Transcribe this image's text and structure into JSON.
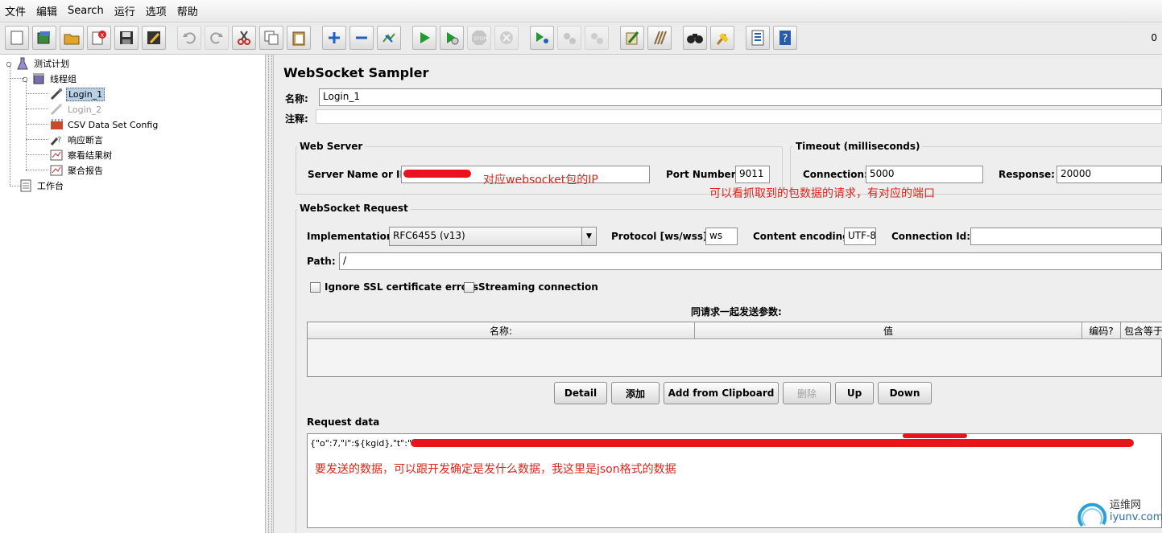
{
  "menu": [
    "文件",
    "编辑",
    "Search",
    "运行",
    "选项",
    "帮助"
  ],
  "toolbar": {
    "icons": [
      "new-icon",
      "templates-icon",
      "open-icon",
      "close-icon",
      "save-icon",
      "save-as-icon",
      "undo-icon",
      "redo-icon",
      "cut-icon",
      "copy-icon",
      "paste-icon",
      "expand-icon",
      "collapse-icon",
      "toggle-icon",
      "start-icon",
      "start-no-pause-icon",
      "stop-icon",
      "shutdown-icon",
      "remote-start-icon",
      "remote-stop-icon",
      "remote-shutdown-icon",
      "clear-icon",
      "clear-all-icon",
      "search-icon",
      "reset-search-icon",
      "function-helper-icon",
      "help-icon"
    ],
    "right_counter": "0"
  },
  "tree": {
    "nodes": [
      {
        "label": "测试计划",
        "icon": "test-plan-icon"
      },
      {
        "label": "线程组",
        "icon": "thread-group-icon"
      },
      {
        "label": "Login_1",
        "icon": "sampler-icon",
        "selected": true
      },
      {
        "label": "Login_2",
        "icon": "sampler-icon",
        "disabled": true
      },
      {
        "label": "CSV Data Set Config",
        "icon": "csv-config-icon"
      },
      {
        "label": "响应断言",
        "icon": "assertion-icon"
      },
      {
        "label": "察看结果树",
        "icon": "listener-icon"
      },
      {
        "label": "聚合报告",
        "icon": "listener-icon"
      },
      {
        "label": "工作台",
        "icon": "workbench-icon"
      }
    ]
  },
  "sampler": {
    "title": "WebSocket Sampler",
    "name_label": "名称:",
    "name_value": "Login_1",
    "comment_label": "注释:",
    "comment_value": "",
    "web_server": {
      "title": "Web Server",
      "server_label": "Server Name or IP:",
      "port_label": "Port Number:",
      "port_value": "9011"
    },
    "timeout": {
      "title": "Timeout (milliseconds)",
      "connection_label": "Connection:",
      "connection_value": "5000",
      "response_label": "Response:",
      "response_value": "20000"
    },
    "request": {
      "title": "WebSocket Request",
      "implementation_label": "Implementation:",
      "implementation_value": "RFC6455 (v13)",
      "protocol_label": "Protocol [ws/wss]:",
      "protocol_value": "ws",
      "encoding_label": "Content encoding:",
      "encoding_value": "UTF-8",
      "connection_id_label": "Connection Id:",
      "connection_id_value": "",
      "path_label": "Path:",
      "path_value": "/",
      "ignore_ssl_label": "Ignore SSL certificate errors",
      "streaming_label": "Streaming connection",
      "params_title": "同请求一起发送参数:",
      "columns": [
        "名称:",
        "值",
        "编码?",
        "包含等于"
      ]
    },
    "buttons": {
      "detail": "Detail",
      "add": "添加",
      "add_clipboard": "Add from Clipboard",
      "delete": "删除",
      "up": "Up",
      "down": "Down"
    },
    "request_data_label": "Request data",
    "request_data_value": "{\"o\":7,\"i\":${kgid},\"t\":\"\",\"s\":"
  },
  "annotations": {
    "ip_note": "对应websocket包的IP",
    "port_note": "可以看抓取到的包数据的请求，有对应的端口",
    "data_note": "要发送的数据，可以跟开发确定是发什么数据，我这里是json格式的数据"
  },
  "watermark": {
    "title": "运维网",
    "url": "iyunv.com"
  },
  "colors": {
    "annotation": "#e0241b",
    "redaction": "#e8141c",
    "selection": "#b8cfe5"
  }
}
